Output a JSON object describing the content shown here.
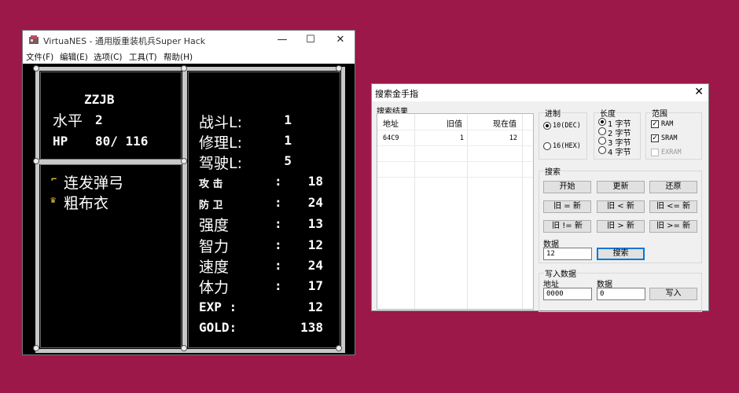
{
  "emulator": {
    "title": "VirtuaNES - 通用版重装机兵Super Hack",
    "menu": [
      "文件(F)",
      "编辑(E)",
      "选项(C)",
      "工具(T)",
      "帮助(H)"
    ],
    "controls": {
      "minimize": "—",
      "maximize": "☐",
      "close": "✕"
    }
  },
  "game": {
    "name": "ZZJB",
    "level_label": "水平",
    "level_value": "2",
    "hp_label": "HP",
    "hp_value": "80/ 116",
    "equipment": [
      {
        "icon": "weapon-icon",
        "name": "连发弹弓"
      },
      {
        "icon": "armor-icon",
        "name": "粗布衣"
      }
    ],
    "skills": [
      {
        "label": "战斗L:",
        "value": "1"
      },
      {
        "label": "修理L:",
        "value": "1"
      },
      {
        "label": "驾驶L:",
        "value": "5"
      }
    ],
    "stats": [
      {
        "label": "攻 击",
        "sep": ":",
        "value": "18"
      },
      {
        "label": "防 卫",
        "sep": ":",
        "value": "24"
      },
      {
        "label": "强度",
        "sep": ":",
        "value": "13"
      },
      {
        "label": "智力",
        "sep": ":",
        "value": "12"
      },
      {
        "label": "速度",
        "sep": ":",
        "value": "24"
      },
      {
        "label": "体力",
        "sep": ":",
        "value": "17"
      }
    ],
    "exp_label": "EXP :",
    "exp_value": "12",
    "gold_label": "GOLD:",
    "gold_value": "138"
  },
  "cheat": {
    "title": "搜索金手指",
    "close": "✕",
    "results_label": "搜索结果",
    "columns": [
      "地址",
      "旧值",
      "现在值"
    ],
    "rows": [
      {
        "addr": "64C9",
        "old": "1",
        "now": "12"
      }
    ],
    "radix": {
      "label": "进制",
      "dec": "10(DEC)",
      "hex": "16(HEX)",
      "selected": "dec"
    },
    "length": {
      "label": "长度",
      "options": [
        "1 字节",
        "2 字节",
        "3 字节",
        "4 字节"
      ],
      "selected": 0
    },
    "range": {
      "label": "范围",
      "ram": "RAM",
      "sram": "SRAM",
      "exram": "EXRAM",
      "ram_checked": true,
      "sram_checked": true,
      "exram_checked": false
    },
    "search": {
      "label": "搜索",
      "buttons": [
        "开始",
        "更新",
        "还原",
        "旧 = 新",
        "旧 < 新",
        "旧 <= 新",
        "旧 != 新",
        "旧 > 新",
        "旧 >= 新"
      ],
      "data_label": "数据",
      "data_value": "12",
      "search_button": "搜索"
    },
    "write": {
      "label": "写入数据",
      "addr_label": "地址",
      "addr_value": "0000",
      "data_label": "数据",
      "data_value": "0",
      "button": "写入"
    }
  }
}
